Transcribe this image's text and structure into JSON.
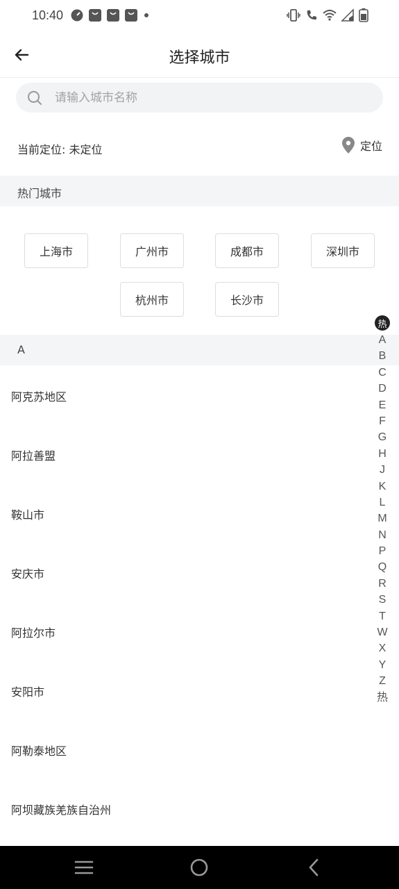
{
  "status_bar": {
    "time": "10:40",
    "left_icons": [
      "speedometer-icon",
      "bag-icon",
      "bag-icon",
      "bag-icon",
      "dot-icon"
    ],
    "right_icons": [
      "vibrate-icon",
      "wifi-call-icon",
      "wifi-icon",
      "signal-icon",
      "battery-icon"
    ]
  },
  "header": {
    "title": "选择城市",
    "back_icon": "arrow-left-icon"
  },
  "search": {
    "placeholder": "请输入城市名称",
    "value": ""
  },
  "location": {
    "current_label": "当前定位: 未定位",
    "action_label": "定位",
    "icon": "map-pin-icon"
  },
  "hot_section": {
    "title": "热门城市",
    "cities": [
      "上海市",
      "广州市",
      "成都市",
      "深圳市",
      "杭州市",
      "长沙市"
    ]
  },
  "list_section": {
    "letter": "A",
    "cities": [
      "阿克苏地区",
      "阿拉善盟",
      "鞍山市",
      "安庆市",
      "阿拉尔市",
      "安阳市",
      "阿勒泰地区",
      "阿坝藏族羌族自治州"
    ]
  },
  "index_bar": {
    "active": "热",
    "letters": [
      "A",
      "B",
      "C",
      "D",
      "E",
      "F",
      "G",
      "H",
      "J",
      "K",
      "L",
      "M",
      "N",
      "P",
      "Q",
      "R",
      "S",
      "T",
      "W",
      "X",
      "Y",
      "Z",
      "热"
    ]
  },
  "nav_bar": {
    "icons": [
      "menu-icon",
      "home-icon",
      "back-icon"
    ]
  },
  "colors": {
    "background": "#ffffff",
    "section_bg": "#f4f5f7",
    "search_bg": "#f2f3f5",
    "text": "#333333",
    "nav_bg": "#000000"
  }
}
